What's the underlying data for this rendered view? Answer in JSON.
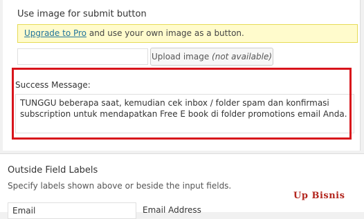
{
  "submit_button_section": {
    "title": "Use image for submit button",
    "notice_link": "Upgrade to Pro",
    "notice_text": " and use your own image as a button.",
    "file_input_value": "",
    "upload_button_label": "Upload image ",
    "upload_button_note": "(not available)"
  },
  "success_message": {
    "label": "Success Message:",
    "value": "TUNGGU beberapa saat, kemudian cek inbox / folder spam dan konfirmasi subscription untuk mendapatkan Free E book di folder promotions email Anda."
  },
  "outside_field_labels": {
    "title": "Outside Field Labels",
    "description": "Specify labels shown above or beside the input fields.",
    "email_value": "Email",
    "email_address_label": "Email Address"
  },
  "watermark": "Up Bisnis",
  "colors": {
    "highlight_border": "#d8141b",
    "notice_background": "#fffbcc",
    "link": "#21759b",
    "watermark": "#b3261e"
  }
}
